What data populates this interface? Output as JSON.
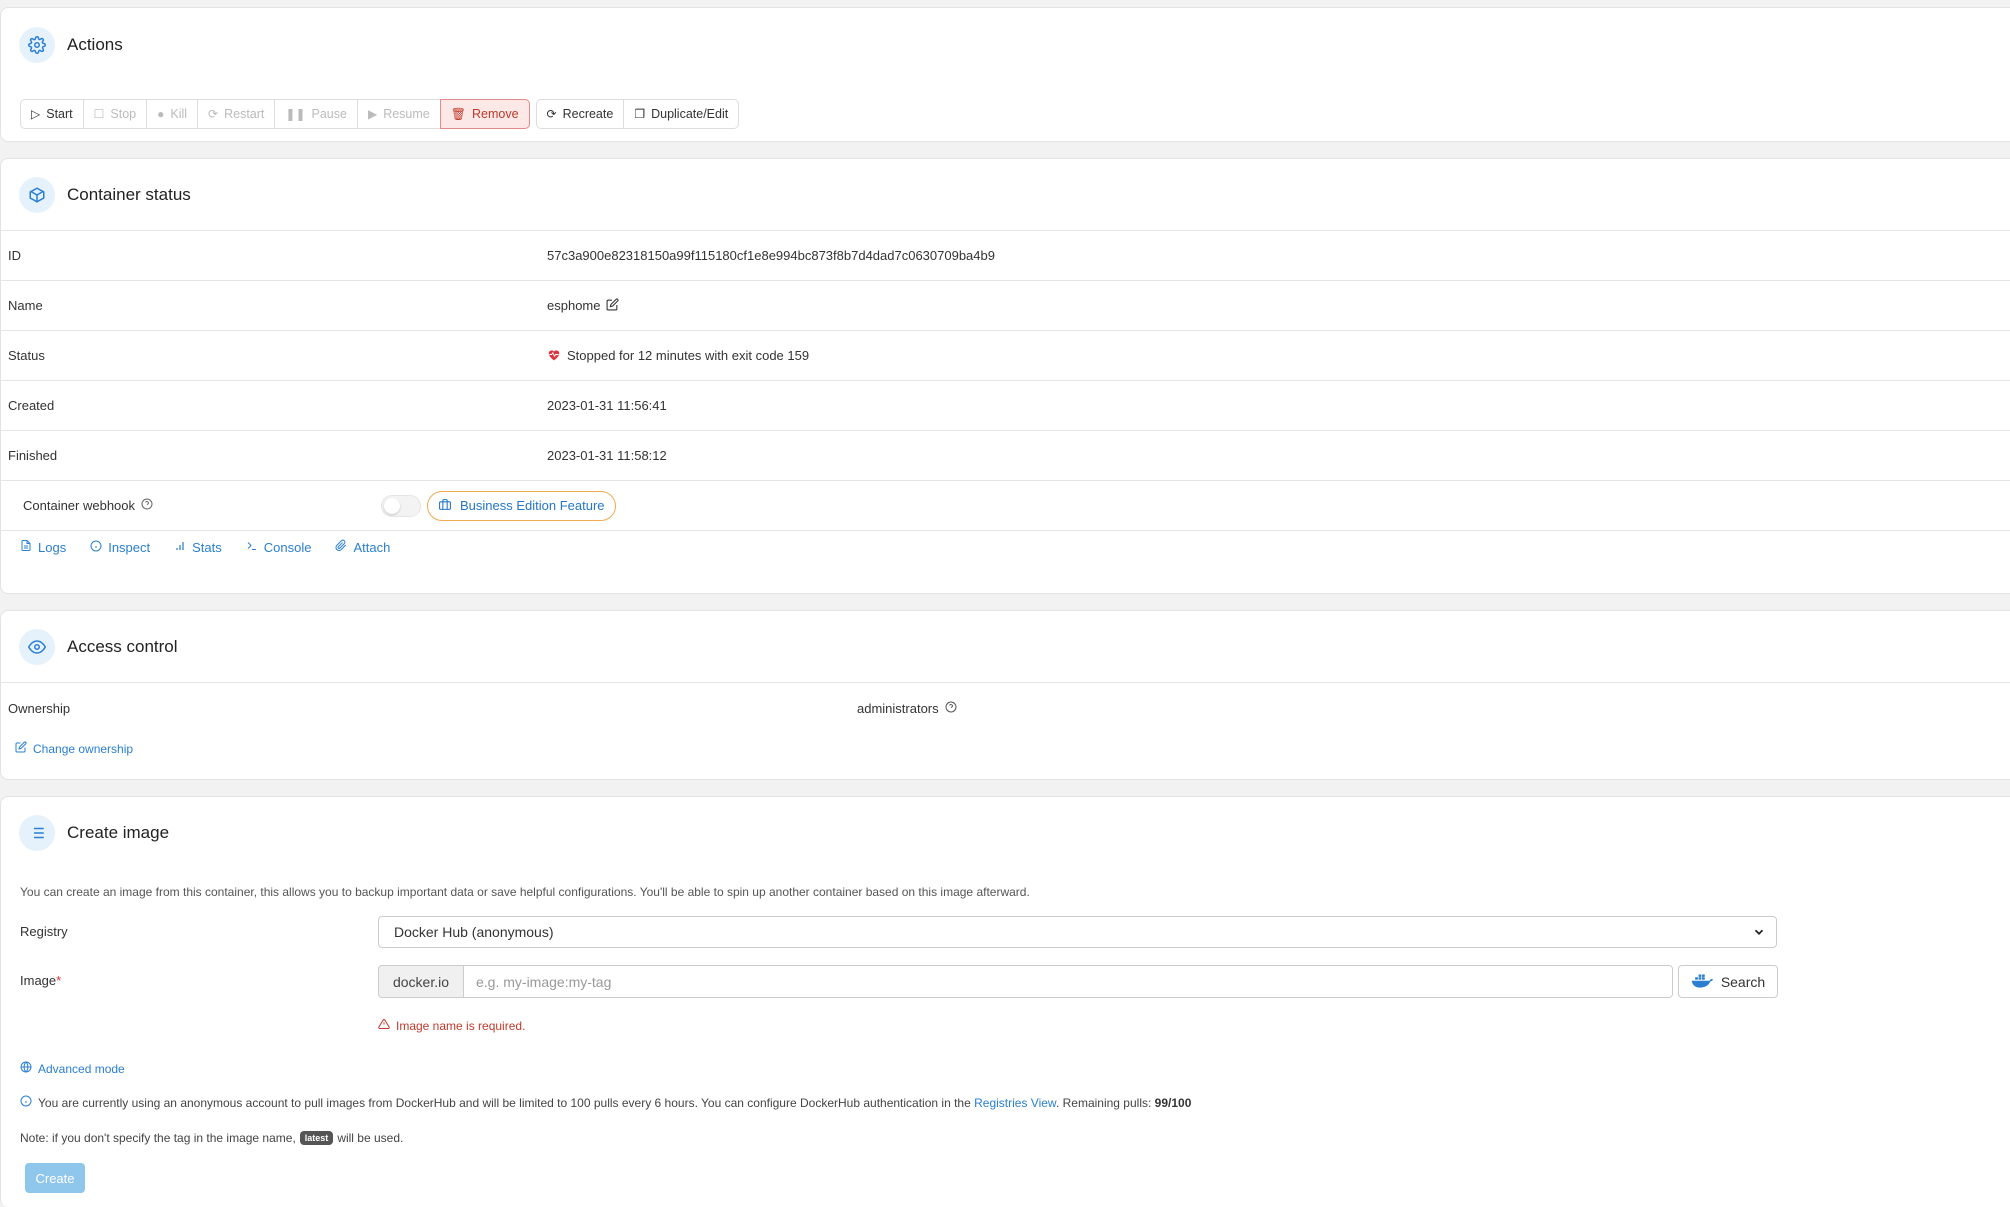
{
  "actions": {
    "title": "Actions",
    "buttons": {
      "start": "Start",
      "stop": "Stop",
      "kill": "Kill",
      "restart": "Restart",
      "pause": "Pause",
      "resume": "Resume",
      "remove": "Remove",
      "recreate": "Recreate",
      "duplicate": "Duplicate/Edit"
    }
  },
  "status": {
    "title": "Container status",
    "rows": {
      "id_label": "ID",
      "id_value": "57c3a900e82318150a99f115180cf1e8e994bc873f8b7d4dad7c0630709ba4b9",
      "name_label": "Name",
      "name_value": "esphome",
      "status_label": "Status",
      "status_value": "Stopped for 12 minutes with exit code 159",
      "created_label": "Created",
      "created_value": "2023-01-31 11:56:41",
      "finished_label": "Finished",
      "finished_value": "2023-01-31 11:58:12",
      "webhook_label": "Container webhook",
      "webhook_badge": "Business Edition Feature"
    },
    "links": {
      "logs": "Logs",
      "inspect": "Inspect",
      "stats": "Stats",
      "console": "Console",
      "attach": "Attach"
    }
  },
  "access": {
    "title": "Access control",
    "ownership_label": "Ownership",
    "ownership_value": "administrators",
    "change_link": "Change ownership"
  },
  "create": {
    "title": "Create image",
    "description": "You can create an image from this container, this allows you to backup important data or save helpful configurations. You'll be able to spin up another container based on this image afterward.",
    "registry_label": "Registry",
    "registry_value": "Docker Hub (anonymous)",
    "image_label": "Image",
    "image_required": "*",
    "image_prefix": "docker.io",
    "image_placeholder": "e.g. my-image:my-tag",
    "search_label": "Search",
    "error": "Image name is required.",
    "advanced_link": "Advanced mode",
    "info_text": "You are currently using an anonymous account to pull images from DockerHub and will be limited to 100 pulls every 6 hours. You can configure DockerHub authentication in the",
    "info_link": "Registries View",
    "info_remaining": ". Remaining pulls:",
    "info_count": "99/100",
    "note_prefix": "Note: if you don't specify the tag in the image name,",
    "note_badge": "latest",
    "note_suffix": "will be used.",
    "create_label": "Create"
  },
  "colors": {
    "accent": "#2a7fd1",
    "danger": "#c0392b",
    "be_border": "#f2a950",
    "heart": "#d9363e"
  }
}
